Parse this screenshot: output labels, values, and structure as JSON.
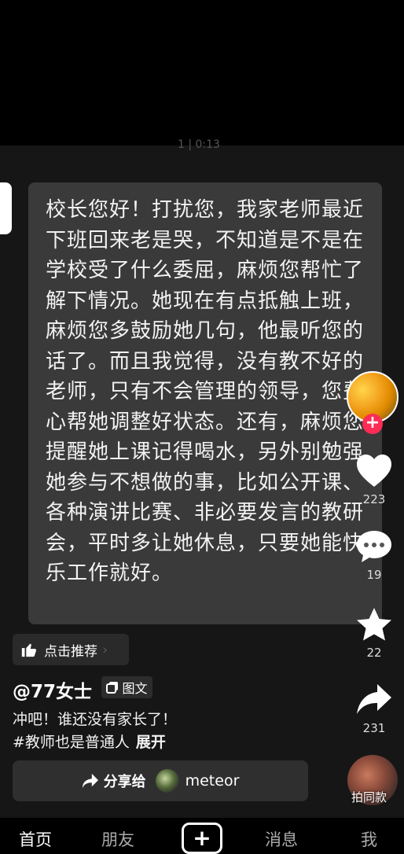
{
  "background_time": "1 | 0:13",
  "message": {
    "text": "校长您好！打扰您，我家老师最近下班回来老是哭，不知道是不是在学校受了什么委屈，麻烦您帮忙了解下情况。她现在有点抵触上班，麻烦您多鼓励她几句，他最听您的话了。而且我觉得，没有教不好的老师，只有不会管理的领导，您费心帮她调整好状态。还有，麻烦您提醒她上课记得喝水，另外别勉强她参与不想做的事，比如公开课、各种演讲比赛、非必要发言的教研会，平时多让她休息，只要她能快乐工作就好。"
  },
  "recommend": {
    "label": "点击推荐",
    "icon": "thumbs-up-icon"
  },
  "post": {
    "author": "@77女士",
    "type_badge": "图文",
    "caption": "冲吧！谁还没有家长了！",
    "hashtag": "#教师也是普通人",
    "expand_label": "展开"
  },
  "share": {
    "label": "分享给",
    "user": "meteor",
    "icon": "share-arrow-icon"
  },
  "sidebar": {
    "likes": "223",
    "comments": "19",
    "favorites": "22",
    "shares": "231",
    "music_label": "拍同款"
  },
  "nav": {
    "home": "首页",
    "friends": "朋友",
    "plus": "+",
    "messages": "消息",
    "me": "我"
  },
  "colors": {
    "accent": "#fe2c55",
    "card": "#3a3a3a",
    "background": "#161616"
  }
}
